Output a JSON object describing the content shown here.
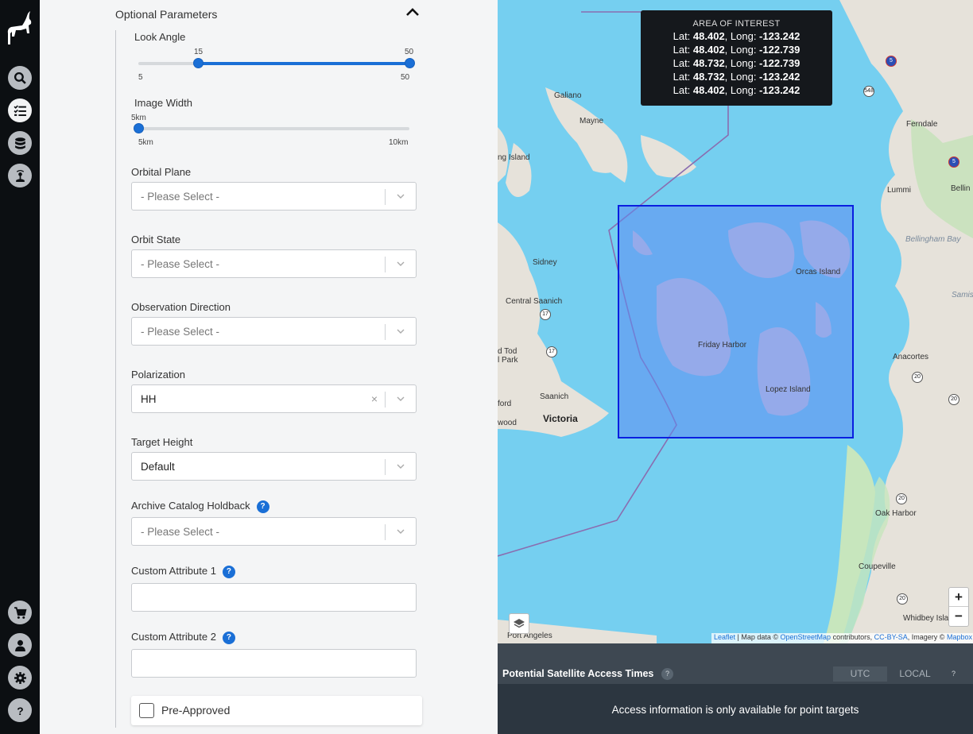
{
  "rail": {
    "icons": [
      "logo-icon",
      "search-icon",
      "tasks-icon",
      "database-icon",
      "satellite-icon",
      "cart-icon",
      "user-icon",
      "gear-icon",
      "help-icon"
    ]
  },
  "form": {
    "section_title": "Optional Parameters",
    "look_angle": {
      "label": "Look Angle",
      "min_val": "5",
      "max_val": "50",
      "low": "15",
      "high": "50",
      "min": 5,
      "max": 50,
      "low_value": 15,
      "high_value": 50
    },
    "image_width": {
      "label": "Image Width",
      "value": "5km",
      "min_label": "5km",
      "max_label": "10km",
      "min": 5,
      "max": 10,
      "current": 5
    },
    "orbital_plane": {
      "label": "Orbital Plane",
      "value": "- Please Select -"
    },
    "orbit_state": {
      "label": "Orbit State",
      "value": "- Please Select -"
    },
    "observation_direction": {
      "label": "Observation Direction",
      "value": "- Please Select -"
    },
    "polarization": {
      "label": "Polarization",
      "value": "HH",
      "clear": "×"
    },
    "target_height": {
      "label": "Target Height",
      "value": "Default"
    },
    "archive_holdback": {
      "label": "Archive Catalog Holdback",
      "value": "- Please Select -",
      "help": "?"
    },
    "custom_attr_1": {
      "label": "Custom Attribute 1",
      "value": "",
      "help": "?"
    },
    "custom_attr_2": {
      "label": "Custom Attribute 2",
      "value": "",
      "help": "?"
    },
    "pre_approved": {
      "label": "Pre-Approved",
      "checked": false
    }
  },
  "map": {
    "aoi": {
      "title": "AREA OF INTEREST",
      "rows": [
        {
          "lat_label": "Lat: ",
          "lat": "48.402",
          "long_label": ", Long: ",
          "long": "-123.242"
        },
        {
          "lat_label": "Lat: ",
          "lat": "48.402",
          "long_label": ", Long: ",
          "long": "-122.739"
        },
        {
          "lat_label": "Lat: ",
          "lat": "48.732",
          "long_label": ", Long: ",
          "long": "-122.739"
        },
        {
          "lat_label": "Lat: ",
          "lat": "48.732",
          "long_label": ", Long: ",
          "long": "-123.242"
        },
        {
          "lat_label": "Lat: ",
          "lat": "48.402",
          "long_label": ", Long: ",
          "long": "-123.242"
        }
      ]
    },
    "labels": {
      "galiano": "Galiano",
      "mayne": "Mayne",
      "sidney": "Sidney",
      "central_saanich": "Central Saanich",
      "saanich": "Saanich",
      "victoria": "Victoria",
      "friday_harbor": "Friday Harbor",
      "orcas_island": "Orcas Island",
      "lopez_island": "Lopez Island",
      "anacortes": "Anacortes",
      "oak_harbor": "Oak Harbor",
      "coupeville": "Coupeville",
      "whidbey_island": "Whidbey Island",
      "port_angeles": "Port Angeles",
      "ferndale": "Ferndale",
      "lummi": "Lummi",
      "bellingham_bay": "Bellingham Bay",
      "bellin": "Bellin",
      "ng_island": "ng Island",
      "d_tod": "d Tod",
      "l_park": "l Park",
      "ford": "ford",
      "wood": "wood",
      "samish": "Samish"
    },
    "shields": {
      "r17a": "17",
      "r17b": "17",
      "r548": "548",
      "r20a": "20",
      "r20b": "20",
      "r20c": "20",
      "r20d": "20",
      "i5a": "5",
      "i5b": "5"
    },
    "zoom_in": "+",
    "zoom_out": "−",
    "attribution": {
      "leaflet": "Leaflet",
      "sep1": " | Map data © ",
      "osm": "OpenStreetMap",
      "contrib": " contributors, ",
      "license": "CC-BY-SA",
      "imagery": ", Imagery © ",
      "mapbox": "Mapbox"
    }
  },
  "access": {
    "title": "Potential Satellite Access Times",
    "help": "?",
    "utc": "UTC",
    "local": "LOCAL",
    "help2": "?",
    "message": "Access information is only available for point targets"
  },
  "colors": {
    "accent": "#1a6fd6",
    "rail": "#0c0f12",
    "water": "#75cff0",
    "aoi_stroke": "#0a1fe0"
  }
}
